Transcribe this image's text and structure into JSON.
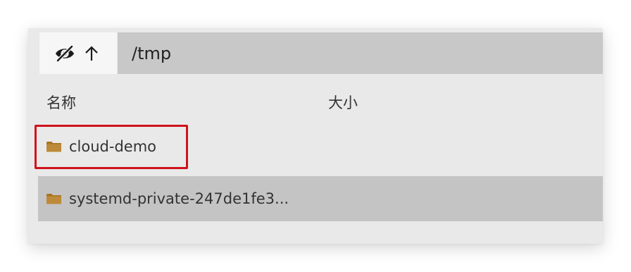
{
  "toolbar": {
    "hide_icon": "eye-slash-icon",
    "up_icon": "arrow-up-icon",
    "path_value": "/tmp"
  },
  "columns": {
    "name": "名称",
    "size": "大小"
  },
  "files": [
    {
      "name": "cloud-demo",
      "icon": "folder-icon",
      "selected": false,
      "highlighted": true
    },
    {
      "name": "systemd-private-247de1fe3...",
      "icon": "folder-icon",
      "selected": true,
      "highlighted": false
    }
  ],
  "colors": {
    "panel_bg": "#e9e9e9",
    "path_bar_bg": "#c8c8c8",
    "selected_row_bg": "#c4c4c4",
    "folder": "#b47f2c",
    "highlight_border": "#d0121b"
  }
}
